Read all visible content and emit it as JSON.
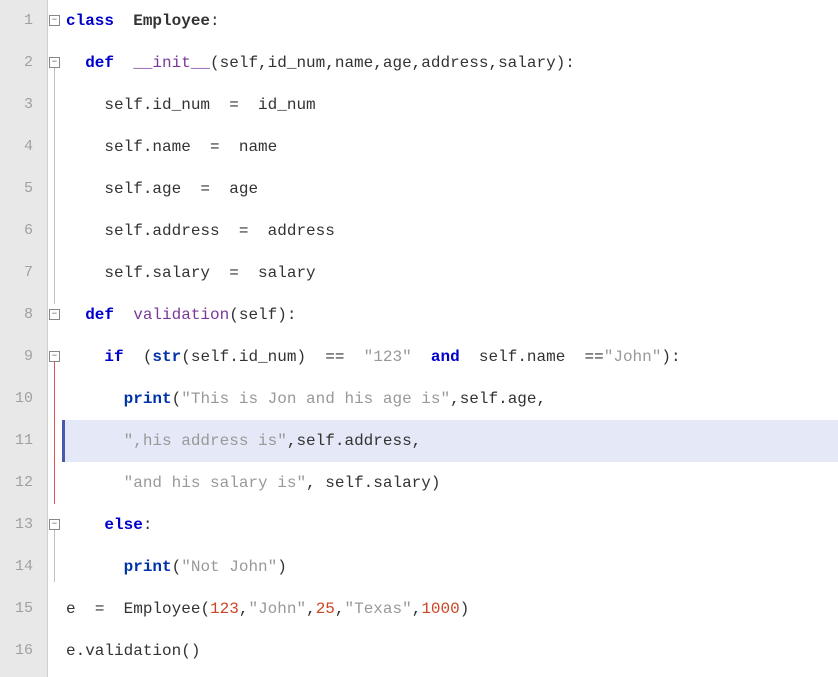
{
  "lines": {
    "l1": "1",
    "l2": "2",
    "l3": "3",
    "l4": "4",
    "l5": "5",
    "l6": "6",
    "l7": "7",
    "l8": "8",
    "l9": "9",
    "l10": "10",
    "l11": "11",
    "l12": "12",
    "l13": "13",
    "l14": "14",
    "l15": "15",
    "l16": "16"
  },
  "code": {
    "c1": {
      "kw": "class",
      "name": "Employee",
      "colon": ":"
    },
    "c2": {
      "kw": "def",
      "fn": "__init__",
      "args": "(self,id_num,name,age,address,salary):"
    },
    "c3": {
      "lhs": "self.id_num",
      "eq": "=",
      "rhs": "id_num"
    },
    "c4": {
      "lhs": "self.name",
      "eq": "=",
      "rhs": "name"
    },
    "c5": {
      "lhs": "self.age",
      "eq": "=",
      "rhs": "age"
    },
    "c6": {
      "lhs": "self.address",
      "eq": "=",
      "rhs": "address"
    },
    "c7": {
      "lhs": "self.salary",
      "eq": "=",
      "rhs": "salary"
    },
    "c8": {
      "kw": "def",
      "fn": "validation",
      "args": "(self):"
    },
    "c9": {
      "kw": "if",
      "lp": "(",
      "strfn": "str",
      "arg": "(self.id_num)",
      "eqeq": "==",
      "s1": "\"123\"",
      "and": "and",
      "expr2": "self.name",
      "eqeq2": "==",
      "s2": "\"John\"",
      "rp": "):"
    },
    "c10": {
      "printkw": "print",
      "lp": "(",
      "s1": "\"This is Jon and his age is\"",
      "comma": ",",
      "arg": "self.age,",
      "rp": ""
    },
    "c11": {
      "s1": "\",his address is\"",
      "comma": ",",
      "arg": "self.address,",
      "rp": ""
    },
    "c12": {
      "s1": "\"and his salary is\"",
      "comma": ",",
      "arg": " self.salary",
      "rp": ")"
    },
    "c13": {
      "kw": "else",
      "colon": ":"
    },
    "c14": {
      "printkw": "print",
      "lp": "(",
      "s1": "\"Not John\"",
      "rp": ")"
    },
    "c15": {
      "lhs": "e",
      "eq": "=",
      "cls": "Employee(",
      "n1": "123",
      "c1": ",",
      "s1": "\"John\"",
      "c2": ",",
      "n2": "25",
      "c3": ",",
      "s2": "\"Texas\"",
      "c4": ",",
      "n3": "1000",
      "rp": ")"
    },
    "c16": {
      "call": "e.validation()"
    }
  }
}
